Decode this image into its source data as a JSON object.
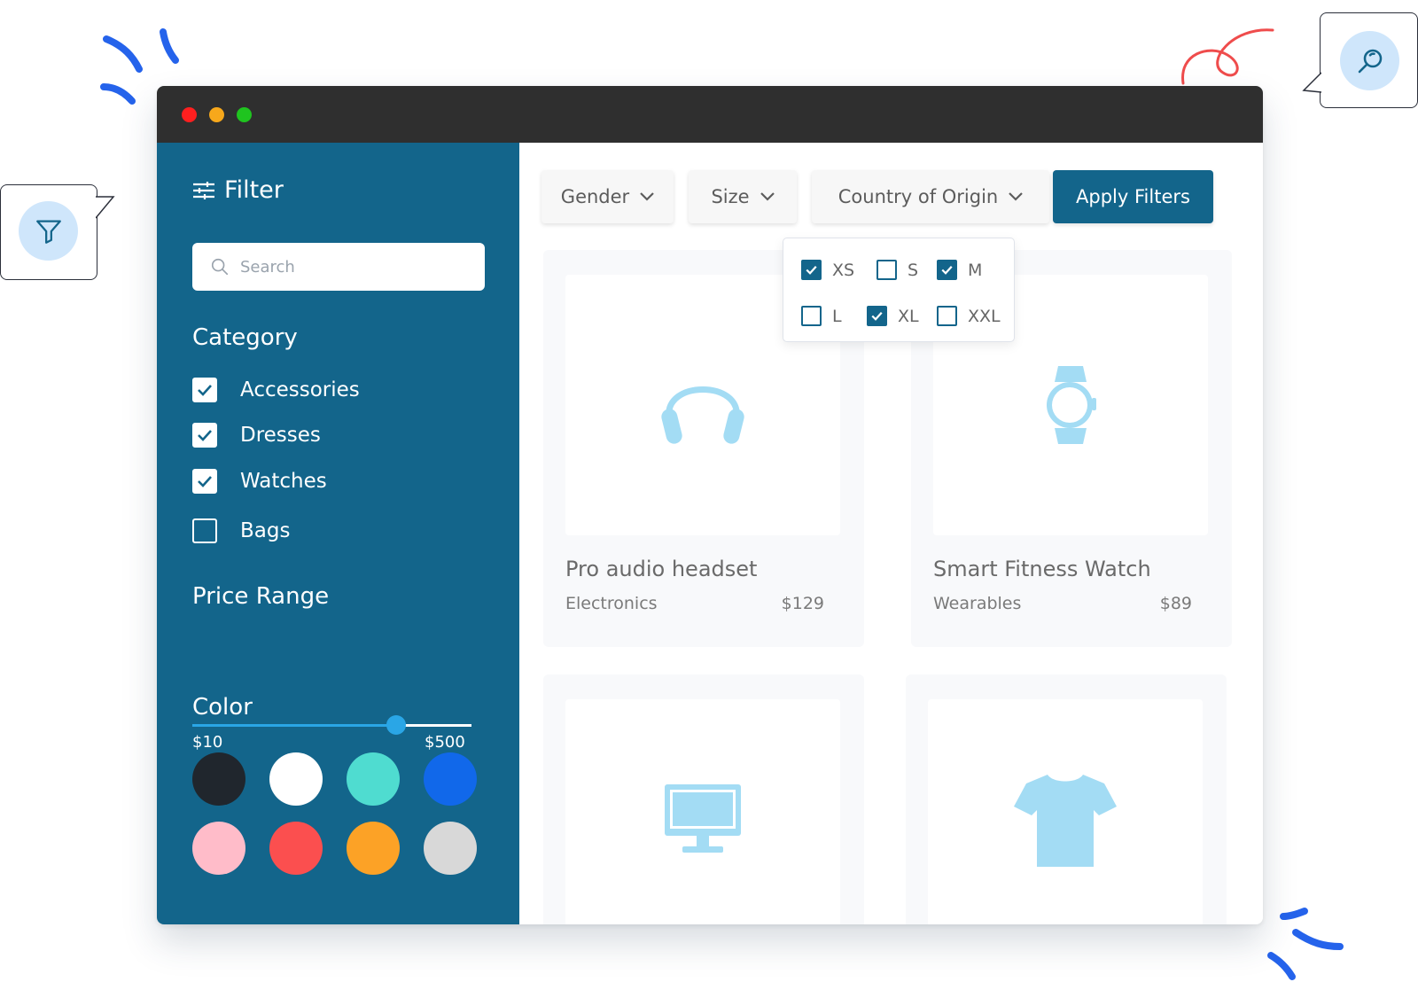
{
  "sidebar": {
    "title": "Filter",
    "search_placeholder": "Search",
    "category_title": "Category",
    "categories": [
      {
        "label": "Accessories",
        "checked": true
      },
      {
        "label": "Dresses",
        "checked": true
      },
      {
        "label": "Watches",
        "checked": true
      },
      {
        "label": "Bags",
        "checked": false
      }
    ],
    "price_title": "Price Range",
    "price_min": "$10",
    "price_max": "$500",
    "price_slider_fraction": 0.73,
    "color_title": "Color",
    "colors": [
      "#20262d",
      "#ffffff",
      "#4fdcd0",
      "#1168ea",
      "#ffbcc9",
      "#fb4f4f",
      "#fca226",
      "#d8d8d8"
    ]
  },
  "filters": {
    "gender": "Gender",
    "size": "Size",
    "country": "Country of Origin",
    "apply": "Apply Filters"
  },
  "size_options": [
    {
      "label": "XS",
      "checked": true
    },
    {
      "label": "S",
      "checked": false
    },
    {
      "label": "M",
      "checked": true
    },
    {
      "label": "L",
      "checked": false
    },
    {
      "label": "XL",
      "checked": true
    },
    {
      "label": "XXL",
      "checked": false
    }
  ],
  "products": [
    {
      "name": "Pro audio headset",
      "category": "Electronics",
      "price": "$129",
      "icon": "headphones-icon"
    },
    {
      "name": "Smart Fitness Watch",
      "category": "Wearables",
      "price": "$89",
      "icon": "smartwatch-icon"
    },
    {
      "name": "",
      "category": "",
      "price": "",
      "icon": "monitor-icon"
    },
    {
      "name": "",
      "category": "",
      "price": "",
      "icon": "tshirt-icon"
    }
  ],
  "theme": {
    "primary": "#13658b",
    "accent": "#2aa6e6",
    "icon_color": "#a3dcf4"
  }
}
